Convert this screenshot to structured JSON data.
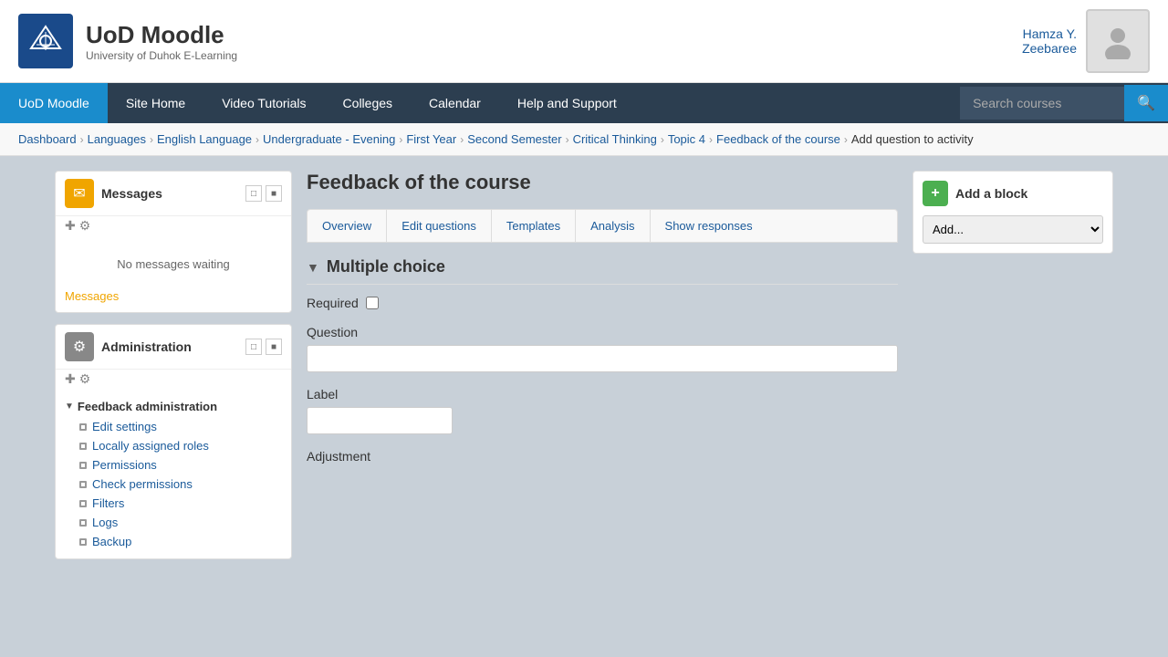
{
  "header": {
    "logo_text": "UoD Moodle",
    "logo_subtitle": "University of Duhok E-Learning",
    "user_name_line1": "Hamza Y.",
    "user_name_line2": "Zeebaree"
  },
  "nav": {
    "items": [
      {
        "label": "UoD Moodle",
        "active": true
      },
      {
        "label": "Site Home",
        "active": false
      },
      {
        "label": "Video Tutorials",
        "active": false
      },
      {
        "label": "Colleges",
        "active": false
      },
      {
        "label": "Calendar",
        "active": false
      },
      {
        "label": "Help and Support",
        "active": false
      }
    ],
    "search_placeholder": "Search courses"
  },
  "breadcrumb": {
    "items": [
      {
        "label": "Dashboard",
        "link": true
      },
      {
        "label": "Languages",
        "link": true
      },
      {
        "label": "English Language",
        "link": true
      },
      {
        "label": "Undergraduate - Evening",
        "link": true
      },
      {
        "label": "First Year",
        "link": true
      },
      {
        "label": "Second Semester",
        "link": true
      },
      {
        "label": "Critical Thinking",
        "link": true
      },
      {
        "label": "Topic 4",
        "link": true
      },
      {
        "label": "Feedback of the course",
        "link": true
      },
      {
        "label": "Add question to activity",
        "link": false
      }
    ]
  },
  "sidebar": {
    "messages_block": {
      "title": "Messages",
      "no_messages": "No messages waiting",
      "link_label": "Messages"
    },
    "admin_block": {
      "title": "Administration",
      "section_label": "Feedback administration",
      "items": [
        "Edit settings",
        "Locally assigned roles",
        "Permissions",
        "Check permissions",
        "Filters",
        "Logs",
        "Backup"
      ]
    }
  },
  "main": {
    "page_title": "Feedback of the course",
    "tabs": [
      {
        "label": "Overview"
      },
      {
        "label": "Edit questions"
      },
      {
        "label": "Templates"
      },
      {
        "label": "Analysis"
      },
      {
        "label": "Show responses"
      }
    ],
    "section_title": "Multiple choice",
    "form": {
      "required_label": "Required",
      "question_label": "Question",
      "question_placeholder": "",
      "label_label": "Label",
      "label_placeholder": "",
      "adjustment_label": "Adjustment"
    }
  },
  "right_sidebar": {
    "add_block_title": "Add a block",
    "add_dropdown_default": "Add..."
  }
}
